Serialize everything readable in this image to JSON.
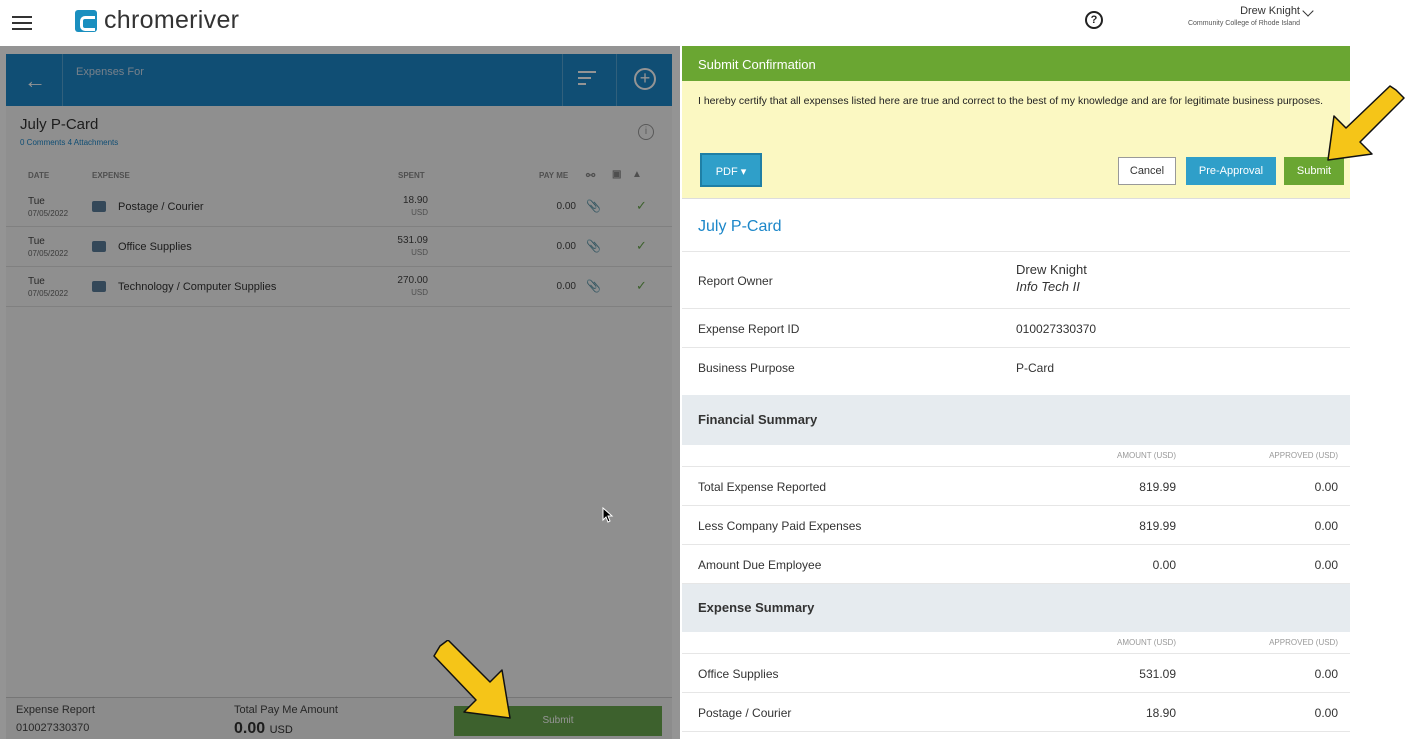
{
  "app": {
    "brand": "chromeriver",
    "help_glyph": "?"
  },
  "user": {
    "name": "Drew Knight",
    "org": "Community College of Rhode Island"
  },
  "left": {
    "header_label": "Expenses For",
    "report_title": "July P-Card",
    "meta": "0 Comments   4 Attachments",
    "columns": {
      "date": "DATE",
      "expense": "EXPENSE",
      "spent": "SPENT",
      "payme": "PAY ME"
    },
    "rows": [
      {
        "day": "Tue",
        "date": "07/05/2022",
        "name": "Postage / Courier",
        "amount": "18.90",
        "currency": "USD",
        "pay": "0.00"
      },
      {
        "day": "Tue",
        "date": "07/05/2022",
        "name": "Office Supplies",
        "amount": "531.09",
        "currency": "USD",
        "pay": "0.00"
      },
      {
        "day": "Tue",
        "date": "07/05/2022",
        "name": "Technology / Computer Supplies",
        "amount": "270.00",
        "currency": "USD",
        "pay": "0.00"
      }
    ],
    "footer": {
      "report_label": "Expense Report",
      "report_id": "010027330370",
      "total_label": "Total Pay Me Amount",
      "total_value": "0.00",
      "total_currency": "USD",
      "submit_label": "Submit"
    }
  },
  "right": {
    "header": "Submit Confirmation",
    "certify": "I hereby certify that all expenses listed here are true and correct to the best of my knowledge and are for legitimate business purposes.",
    "buttons": {
      "pdf": "PDF",
      "cancel": "Cancel",
      "preapproval": "Pre-Approval",
      "submit": "Submit"
    },
    "title": "July P-Card",
    "owner_label": "Report Owner",
    "owner_name": "Drew Knight",
    "owner_title": "Info Tech II",
    "id_label": "Expense Report ID",
    "id_value": "010027330370",
    "purpose_label": "Business Purpose",
    "purpose_value": "P-Card",
    "financial": {
      "title": "Financial Summary",
      "col_amount": "AMOUNT (USD)",
      "col_approved": "APPROVED (USD)",
      "rows": [
        {
          "label": "Total Expense Reported",
          "amount": "819.99",
          "approved": "0.00"
        },
        {
          "label": "Less Company Paid Expenses",
          "amount": "819.99",
          "approved": "0.00"
        },
        {
          "label": "Amount Due Employee",
          "amount": "0.00",
          "approved": "0.00"
        }
      ]
    },
    "expense_summary": {
      "title": "Expense Summary",
      "col_amount": "AMOUNT (USD)",
      "col_approved": "APPROVED (USD)",
      "rows": [
        {
          "label": "Office Supplies",
          "amount": "531.09",
          "approved": "0.00"
        },
        {
          "label": "Postage / Courier",
          "amount": "18.90",
          "approved": "0.00"
        }
      ]
    }
  },
  "colors": {
    "accent_blue": "#1c87c9",
    "submit_green": "#6aa632",
    "cert_yellow": "#fbf8c2",
    "arrow_yellow": "#f5c518"
  }
}
